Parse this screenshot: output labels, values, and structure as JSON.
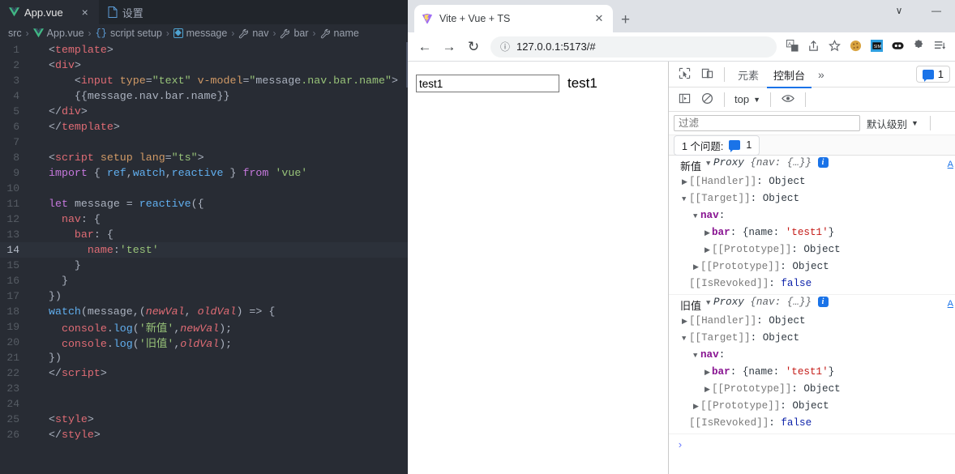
{
  "editor": {
    "tabs": [
      {
        "label": "App.vue",
        "icon": "vue-logo-icon",
        "active": true,
        "close": "×"
      },
      {
        "label": "设置",
        "icon": "file-icon",
        "active": false,
        "close": "×"
      }
    ],
    "breadcrumb": [
      {
        "label": "src",
        "icon": ""
      },
      {
        "label": "App.vue",
        "icon": "vue-logo-icon"
      },
      {
        "label": "script setup",
        "icon": "braces-icon"
      },
      {
        "label": "message",
        "icon": "field-icon"
      },
      {
        "label": "nav",
        "icon": "wrench-icon"
      },
      {
        "label": "bar",
        "icon": "wrench-icon"
      },
      {
        "label": "name",
        "icon": "wrench-icon"
      }
    ],
    "separator": "›",
    "active_line": 14,
    "total_lines": 26,
    "code_lines": [
      {
        "n": 1,
        "text": "<template>"
      },
      {
        "n": 2,
        "text": "<div>"
      },
      {
        "n": 3,
        "text": "    <input type=\"text\" v-model=\"message.nav.bar.name\">"
      },
      {
        "n": 4,
        "text": "    {{message.nav.bar.name}}"
      },
      {
        "n": 5,
        "text": "</div>"
      },
      {
        "n": 6,
        "text": "</template>"
      },
      {
        "n": 7,
        "text": ""
      },
      {
        "n": 8,
        "text": "<script setup lang=\"ts\">"
      },
      {
        "n": 9,
        "text": "import { ref,watch,reactive } from 'vue'"
      },
      {
        "n": 10,
        "text": ""
      },
      {
        "n": 11,
        "text": "let message = reactive({"
      },
      {
        "n": 12,
        "text": "  nav: {"
      },
      {
        "n": 13,
        "text": "    bar: {"
      },
      {
        "n": 14,
        "text": "      name:'test'"
      },
      {
        "n": 15,
        "text": "    }"
      },
      {
        "n": 16,
        "text": "  }"
      },
      {
        "n": 17,
        "text": "})"
      },
      {
        "n": 18,
        "text": "watch(message,(newVal, oldVal) => {"
      },
      {
        "n": 19,
        "text": "  console.log('新值',newVal);"
      },
      {
        "n": 20,
        "text": "  console.log('旧值',oldVal);"
      },
      {
        "n": 21,
        "text": "})"
      },
      {
        "n": 22,
        "text": "</script>"
      },
      {
        "n": 23,
        "text": ""
      },
      {
        "n": 24,
        "text": ""
      },
      {
        "n": 25,
        "text": "<style>"
      },
      {
        "n": 26,
        "text": "</style>"
      }
    ]
  },
  "browser": {
    "tab": {
      "title": "Vite + Vue + TS",
      "favicon": "vite-logo-icon",
      "close": "✕"
    },
    "new_tab_label": "+",
    "window_controls": {
      "chevron": "∨",
      "minimize": "—"
    },
    "toolbar": {
      "back": "←",
      "forward": "→",
      "reload": "↻",
      "site_info": "ⓘ",
      "url": "127.0.0.1:5173/#",
      "icons": [
        "translate-icon",
        "share-icon",
        "bookmark-star-icon",
        "cookie-icon",
        "sim-extension-icon",
        "dark-oval-extension-icon",
        "puzzle-extension-icon",
        "menu-icon"
      ]
    }
  },
  "page": {
    "input_value": "test1",
    "input_placeholder": "",
    "rendered_text": "test1"
  },
  "devtools": {
    "toolbar_icons": [
      "inspect-element-icon",
      "device-toolbar-icon"
    ],
    "tabs": [
      {
        "label": "元素",
        "active": false
      },
      {
        "label": "控制台",
        "active": true
      }
    ],
    "more_tabs": "»",
    "message_badge": {
      "count": "1",
      "icon": "message-bubble-icon"
    },
    "sidebar_toggle_icon": "console-sidebar-icon",
    "clear_icon": "clear-console-icon",
    "context": "top",
    "context_caret": "▼",
    "eye_icon": "live-expression-eye-icon",
    "filter_placeholder": "过滤",
    "level_label": "默认级别",
    "level_caret": "▼",
    "issues_text": "1 个问题:",
    "issues_count": "1",
    "prompt": "›",
    "logs": [
      {
        "label": "新值",
        "proxy": "Proxy",
        "preview": "{nav: {…}}",
        "info_icon": "i",
        "source": "A",
        "rows": [
          {
            "indent": 1,
            "arrow": "▶",
            "key": "[[Handler]]",
            "keyclass": "k-internal",
            "sep": ":",
            "value": "Object",
            "valclass": "v-obj"
          },
          {
            "indent": 1,
            "arrow": "▼",
            "key": "[[Target]]",
            "keyclass": "k-internal",
            "sep": ":",
            "value": "Object",
            "valclass": "v-obj"
          },
          {
            "indent": 2,
            "arrow": "▼",
            "key": "nav",
            "keyclass": "k-prop",
            "sep": ":",
            "value": "",
            "valclass": "v-obj"
          },
          {
            "indent": 3,
            "arrow": "▶",
            "key": "bar",
            "keyclass": "k-prop",
            "sep": ":",
            "value": "{name: 'test1'}",
            "valclass": "v-objstr"
          },
          {
            "indent": 3,
            "arrow": "▶",
            "key": "[[Prototype]]",
            "keyclass": "k-internal",
            "sep": ":",
            "value": "Object",
            "valclass": "v-obj"
          },
          {
            "indent": 2,
            "arrow": "▶",
            "key": "[[Prototype]]",
            "keyclass": "k-internal",
            "sep": ":",
            "value": "Object",
            "valclass": "v-obj"
          },
          {
            "indent": 1,
            "arrow": "",
            "key": "[[IsRevoked]]",
            "keyclass": "k-internal",
            "sep": ":",
            "value": "false",
            "valclass": "v-bool"
          }
        ]
      },
      {
        "label": "旧值",
        "proxy": "Proxy",
        "preview": "{nav: {…}}",
        "info_icon": "i",
        "source": "A",
        "rows": [
          {
            "indent": 1,
            "arrow": "▶",
            "key": "[[Handler]]",
            "keyclass": "k-internal",
            "sep": ":",
            "value": "Object",
            "valclass": "v-obj"
          },
          {
            "indent": 1,
            "arrow": "▼",
            "key": "[[Target]]",
            "keyclass": "k-internal",
            "sep": ":",
            "value": "Object",
            "valclass": "v-obj"
          },
          {
            "indent": 2,
            "arrow": "▼",
            "key": "nav",
            "keyclass": "k-prop",
            "sep": ":",
            "value": "",
            "valclass": "v-obj"
          },
          {
            "indent": 3,
            "arrow": "▶",
            "key": "bar",
            "keyclass": "k-prop",
            "sep": ":",
            "value": "{name: 'test1'}",
            "valclass": "v-objstr"
          },
          {
            "indent": 3,
            "arrow": "▶",
            "key": "[[Prototype]]",
            "keyclass": "k-internal",
            "sep": ":",
            "value": "Object",
            "valclass": "v-obj"
          },
          {
            "indent": 2,
            "arrow": "▶",
            "key": "[[Prototype]]",
            "keyclass": "k-internal",
            "sep": ":",
            "value": "Object",
            "valclass": "v-obj"
          },
          {
            "indent": 1,
            "arrow": "",
            "key": "[[IsRevoked]]",
            "keyclass": "k-internal",
            "sep": ":",
            "value": "false",
            "valclass": "v-bool"
          }
        ]
      }
    ]
  },
  "colors": {
    "editor_bg": "#282c34",
    "editor_tabbar_bg": "#21252b",
    "accent_blue": "#1a73e8",
    "vue_green": "#41b883",
    "string_green": "#98c379",
    "tag_red": "#e06c75"
  }
}
